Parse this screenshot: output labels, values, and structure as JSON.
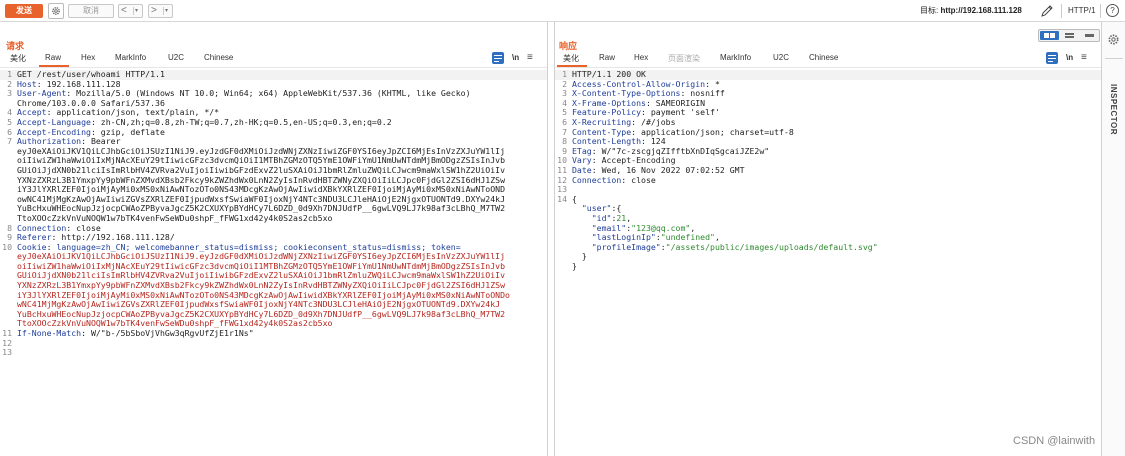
{
  "toolbar": {
    "send_label": "发送",
    "cancel_label": "取消",
    "back_arrow": "<",
    "forward_arrow": ">",
    "dropdown_arrow": "▾",
    "target_prefix": "目标: ",
    "target_url": "http://192.168.111.128",
    "http_version": "HTTP/1",
    "help_label": "?"
  },
  "request": {
    "title": "请求",
    "tabs": [
      "美化",
      "Raw",
      "Hex",
      "MarkInfo",
      "U2C",
      "Chinese"
    ],
    "active_tab": "Raw",
    "newline_toggle": "\\n",
    "lines": [
      {
        "n": "1",
        "parts": [
          {
            "t": "GET /rest/user/whoami HTTP/1.1",
            "c": ""
          }
        ]
      },
      {
        "n": "2",
        "parts": [
          {
            "t": "Host",
            "c": "key"
          },
          {
            "t": ": 192.168.111.128",
            "c": ""
          }
        ]
      },
      {
        "n": "3",
        "parts": [
          {
            "t": "User-Agent",
            "c": "key"
          },
          {
            "t": ": Mozilla/5.0 (Windows NT 10.0; Win64; x64) AppleWebKit/537.36 (KHTML, like Gecko)",
            "c": ""
          }
        ]
      },
      {
        "n": "",
        "parts": [
          {
            "t": "Chrome/103.0.0.0 Safari/537.36",
            "c": ""
          }
        ]
      },
      {
        "n": "4",
        "parts": [
          {
            "t": "Accept",
            "c": "key"
          },
          {
            "t": ": application/json, text/plain, */*",
            "c": ""
          }
        ]
      },
      {
        "n": "5",
        "parts": [
          {
            "t": "Accept-Language",
            "c": "key"
          },
          {
            "t": ": zh-CN,zh;q=0.8,zh-TW;q=0.7,zh-HK;q=0.5,en-US;q=0.3,en;q=0.2",
            "c": ""
          }
        ]
      },
      {
        "n": "6",
        "parts": [
          {
            "t": "Accept-Encoding",
            "c": "key"
          },
          {
            "t": ": gzip, deflate",
            "c": ""
          }
        ]
      },
      {
        "n": "7",
        "parts": [
          {
            "t": "Authorization",
            "c": "key"
          },
          {
            "t": ": Bearer",
            "c": ""
          }
        ]
      },
      {
        "n": "",
        "parts": [
          {
            "t": "eyJ0eXAiOiJKV1QiLCJhbGciOiJSUzI1NiJ9.eyJzdGF0dXMiOiJzdWNjZXNzIiwiZGF0YSI6eyJpZCI6MjEsInVzZXJuYW1lIj",
            "c": ""
          }
        ]
      },
      {
        "n": "",
        "parts": [
          {
            "t": "oiIiwiZW1haWwiOiIxMjNAcXEuY29tIiwicGFzc3dvcmQiOiI1MTBhZGMzOTQ5YmE1OWFiYmU1NmUwNTdmMjBmODgzZSIsInJvb",
            "c": ""
          }
        ]
      },
      {
        "n": "",
        "parts": [
          {
            "t": "GUiOiJjdXN0b21lciIsImRlbHV4ZVRva2VuIjoiIiwibGFzdExvZ2luSXAiOiJ1bmRlZmluZWQiLCJwcm9maWxlSW1hZ2UiOiIv",
            "c": ""
          }
        ]
      },
      {
        "n": "",
        "parts": [
          {
            "t": "YXNzZXRzL3B1YmxpYy9pbWFnZXMvdXBsb2Fkcy9kZWZhdWx0LnN2ZyIsInRvdHBTZWNyZXQiOiIiLCJpc0FjdGl2ZSI6dHJ1ZSw",
            "c": ""
          }
        ]
      },
      {
        "n": "",
        "parts": [
          {
            "t": "iY3JlYXRlZEF0IjoiMjAyMi0xMS0xNiAwNTozOTo0NS43MDcgKzAwOjAwIiwidXBkYXRlZEF0IjoiMjAyMi0xMS0xNiAwNToOND",
            "c": ""
          }
        ]
      },
      {
        "n": "",
        "parts": [
          {
            "t": "owNC41MjMgKzAwOjAwIiwiZGVsZXRlZEF0IjpudWxsfSwiaWF0IjoxNjY4NTc3NDU3LCJleHAiOjE2NjgxOTUONTd9.DXYw24kJ",
            "c": ""
          }
        ]
      },
      {
        "n": "",
        "parts": [
          {
            "t": "YuBcHxuWHEocNupJzjocpCWAoZPByvaJgcZ5K2CXUXYpBYdHCy7L6DZD_0d9Xh7DNJUdfP__6gwLVQ9LJ7k98af3cLBhQ_M7TW2",
            "c": ""
          }
        ]
      },
      {
        "n": "",
        "parts": [
          {
            "t": "TtoXOOcZzkVnVuNOQW1w7bTK4venFwSeWDu0shpF_fFWG1xd42y4k0S2as2cb5xo",
            "c": ""
          }
        ]
      },
      {
        "n": "8",
        "parts": [
          {
            "t": "Connection",
            "c": "key"
          },
          {
            "t": ": close",
            "c": ""
          }
        ]
      },
      {
        "n": "9",
        "parts": [
          {
            "t": "Referer",
            "c": "key"
          },
          {
            "t": ": http://192.168.111.128/",
            "c": ""
          }
        ]
      },
      {
        "n": "10",
        "parts": [
          {
            "t": "Cookie",
            "c": "key"
          },
          {
            "t": ": ",
            "c": ""
          },
          {
            "t": "language=zh_CN; welcomebanner_status=dismiss; cookieconsent_status=dismiss; token=",
            "c": "cookie"
          }
        ]
      },
      {
        "n": "",
        "parts": [
          {
            "t": "eyJ0eXAiOiJKV1QiLCJhbGciOiJSUzI1NiJ9.eyJzdGF0dXMiOiJzdWNjZXNzIiwiZGF0YSI6eyJpZCI6MjEsInVzZXJuYW1lIj",
            "c": "jwt"
          }
        ]
      },
      {
        "n": "",
        "parts": [
          {
            "t": "oiIiwiZW1haWwiOiIxMjNAcXEuY29tIiwicGFzc3dvcmQiOiI1MTBhZGMzOTQ5YmE1OWFiYmU1NmUwNTdmMjBmODgzZSIsInJvb",
            "c": "jwt"
          }
        ]
      },
      {
        "n": "",
        "parts": [
          {
            "t": "GUiOiJjdXN0b21lciIsImRlbHV4ZVRva2VuIjoiIiwibGFzdExvZ2luSXAiOiJ1bmRlZmluZWQiLCJwcm9maWxlSW1hZ2UiOiIv",
            "c": "jwt"
          }
        ]
      },
      {
        "n": "",
        "parts": [
          {
            "t": "YXNzZXRzL3B1YmxpYy9pbWFnZXMvdXBsb2Fkcy9kZWZhdWx0LnN2ZyIsInRvdHBTZWNyZXQiOiIiLCJpc0FjdGl2ZSI6dHJ1ZSw",
            "c": "jwt"
          }
        ]
      },
      {
        "n": "",
        "parts": [
          {
            "t": "iY3JlYXRlZEF0IjoiMjAyMi0xMS0xNiAwNTozOTo0NS43MDcgKzAwOjAwIiwidXBkYXRlZEF0IjoiMjAyMi0xMS0xNiAwNToONDo",
            "c": "jwt"
          }
        ]
      },
      {
        "n": "",
        "parts": [
          {
            "t": "wNC41MjMgKzAwOjAwIiwiZGVsZXRlZEF0IjpudWxsfSwiaWF0IjoxNjY4NTc3NDU3LCJleHAiOjE2NjgxOTUONTd9.DXYw24kJ",
            "c": "jwt"
          }
        ]
      },
      {
        "n": "",
        "parts": [
          {
            "t": "YuBcHxuWHEocNupJzjocpCWAoZPByvaJgcZ5K2CXUXYpBYdHCy7L6DZD_0d9Xh7DNJUdfP__6gwLVQ9LJ7k98af3cLBhQ_M7TW2",
            "c": "jwt"
          }
        ]
      },
      {
        "n": "",
        "parts": [
          {
            "t": "TtoXOOcZzkVnVuNOQW1w7bTK4venFwSeWDu0shpF_fFWG1xd42y4k0S2as2cb5xo",
            "c": "jwt"
          }
        ]
      },
      {
        "n": "11",
        "parts": [
          {
            "t": "If-None-Match",
            "c": "key"
          },
          {
            "t": ": W/\"b-/5bSboVjVhGw3qRgvUfZjE1r1Ns\"",
            "c": ""
          }
        ]
      },
      {
        "n": "12",
        "parts": []
      },
      {
        "n": "13",
        "parts": []
      }
    ]
  },
  "response": {
    "title": "响应",
    "tabs": [
      "美化",
      "Raw",
      "Hex",
      "页面渲染",
      "MarkInfo",
      "U2C",
      "Chinese"
    ],
    "active_tab": "美化",
    "newline_toggle": "\\n",
    "lines": [
      {
        "n": "1",
        "parts": [
          {
            "t": "HTTP/1.1 200 OK",
            "c": ""
          }
        ]
      },
      {
        "n": "2",
        "parts": [
          {
            "t": "Access-Control-Allow-Origin",
            "c": "key"
          },
          {
            "t": ": *",
            "c": ""
          }
        ]
      },
      {
        "n": "3",
        "parts": [
          {
            "t": "X-Content-Type-Options",
            "c": "key"
          },
          {
            "t": ": nosniff",
            "c": ""
          }
        ]
      },
      {
        "n": "4",
        "parts": [
          {
            "t": "X-Frame-Options",
            "c": "key"
          },
          {
            "t": ": SAMEORIGIN",
            "c": ""
          }
        ]
      },
      {
        "n": "5",
        "parts": [
          {
            "t": "Feature-Policy",
            "c": "key"
          },
          {
            "t": ": payment 'self'",
            "c": ""
          }
        ]
      },
      {
        "n": "6",
        "parts": [
          {
            "t": "X-Recruiting",
            "c": "key"
          },
          {
            "t": ": /#/jobs",
            "c": ""
          }
        ]
      },
      {
        "n": "7",
        "parts": [
          {
            "t": "Content-Type",
            "c": "key"
          },
          {
            "t": ": application/json; charset=utf-8",
            "c": ""
          }
        ]
      },
      {
        "n": "8",
        "parts": [
          {
            "t": "Content-Length",
            "c": "key"
          },
          {
            "t": ": 124",
            "c": ""
          }
        ]
      },
      {
        "n": "9",
        "parts": [
          {
            "t": "ETag",
            "c": "key"
          },
          {
            "t": ": W/\"7c-zscgjqZIfftbXnDIqSgcaiJZE2w\"",
            "c": ""
          }
        ]
      },
      {
        "n": "10",
        "parts": [
          {
            "t": "Vary",
            "c": "key"
          },
          {
            "t": ": Accept-Encoding",
            "c": ""
          }
        ]
      },
      {
        "n": "11",
        "parts": [
          {
            "t": "Date",
            "c": "key"
          },
          {
            "t": ": Wed, 16 Nov 2022 07:02:52 GMT",
            "c": ""
          }
        ]
      },
      {
        "n": "12",
        "parts": [
          {
            "t": "Connection",
            "c": "key"
          },
          {
            "t": ": close",
            "c": ""
          }
        ]
      },
      {
        "n": "13",
        "parts": []
      },
      {
        "n": "14",
        "parts": [
          {
            "t": "{",
            "c": ""
          }
        ]
      },
      {
        "n": "",
        "parts": [
          {
            "t": "  \"user\"",
            "c": "jkey"
          },
          {
            "t": ":{",
            "c": ""
          }
        ]
      },
      {
        "n": "",
        "parts": [
          {
            "t": "    \"id\"",
            "c": "jkey"
          },
          {
            "t": ":",
            "c": ""
          },
          {
            "t": "21",
            "c": "jnum"
          },
          {
            "t": ",",
            "c": ""
          }
        ]
      },
      {
        "n": "",
        "parts": [
          {
            "t": "    \"email\"",
            "c": "jkey"
          },
          {
            "t": ":",
            "c": ""
          },
          {
            "t": "\"123@qq.com\"",
            "c": "jstr"
          },
          {
            "t": ",",
            "c": ""
          }
        ]
      },
      {
        "n": "",
        "parts": [
          {
            "t": "    \"lastLoginIp\"",
            "c": "jkey"
          },
          {
            "t": ":",
            "c": ""
          },
          {
            "t": "\"undefined\"",
            "c": "jstr"
          },
          {
            "t": ",",
            "c": ""
          }
        ]
      },
      {
        "n": "",
        "parts": [
          {
            "t": "    \"profileImage\"",
            "c": "jkey"
          },
          {
            "t": ":",
            "c": ""
          },
          {
            "t": "\"/assets/public/images/uploads/default.svg\"",
            "c": "jstr"
          }
        ]
      },
      {
        "n": "",
        "parts": [
          {
            "t": "  }",
            "c": ""
          }
        ]
      },
      {
        "n": "",
        "parts": [
          {
            "t": "}",
            "c": ""
          }
        ]
      }
    ]
  },
  "sidebar": {
    "inspector_label": "INSPECTOR"
  },
  "watermark": "CSDN @lainwith",
  "colors": {
    "accent": "#e8632c",
    "header_key": "#1f3e99",
    "jwt": "#b5261e",
    "json_string": "#2f8a2f",
    "toggle_blue": "#2f6fc0"
  }
}
